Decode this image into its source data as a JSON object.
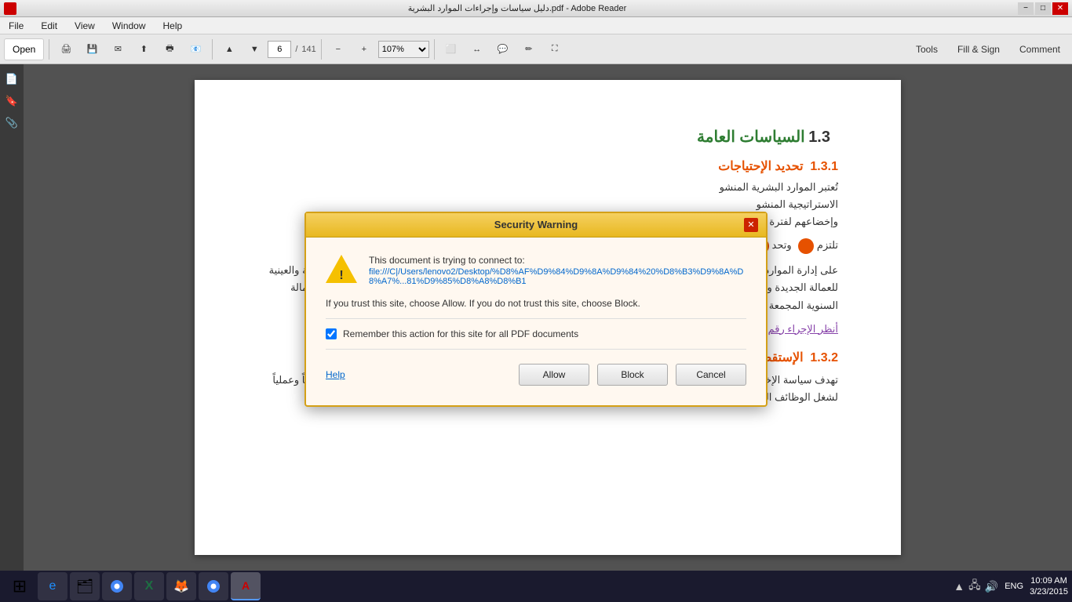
{
  "titlebar": {
    "title": "دليل سياسات وإجراءات الموارد البشرية.pdf - Adobe Reader",
    "minimize": "−",
    "maximize": "□",
    "close": "✕"
  },
  "menubar": {
    "items": [
      "File",
      "Edit",
      "View",
      "Window",
      "Help"
    ]
  },
  "toolbar": {
    "open_label": "Open",
    "page_current": "6",
    "page_total": "141",
    "zoom_value": "107%",
    "tools_label": "Tools",
    "fill_sign_label": "Fill & Sign",
    "comment_label": "Comment"
  },
  "pdf": {
    "section_num": "1.3",
    "section_title": "السياسات العامة",
    "subsection1_num": "1.3.1",
    "subsection1_title": "تحديد الإحتياجات",
    "subsection1_text1": "تُعتبر الموارد البشرية المنشو",
    "subsection1_text2": "الاستراتيجية المنشو",
    "subsection1_text3": "وإخضاعهم لفترة إخ",
    "subsection1_text4": "تلتزم",
    "subsection1_text5": "وتحد",
    "subsection1_body": "على إدارة الموارد البشرية إصدار خطة العمالة السنوية والتي تتضمن الميزانية التقديرية السنوية المتعلقة بالمرتبات والمزايا النقدية والعينية للعمالة الجديدة وعرضها على الإدارة العليا وإعتمادها في موعد غايته قبل نهاية ذات العام الميلادي، ويخضع أي تعديل على خطة العمالة السنوية المجمعة المعتمدة لدراسة مدير إدارة الموارد البشرية وإعتماد الإدارة العُليا.",
    "pdf_link": "أنظر الإجراء رقم (ع.م.ب.01/01) و رقم (ع.م.ب.01/02)",
    "subsection2_num": "1.3.2",
    "subsection2_title": "الإستقطاب والإختياروالتعيين",
    "subsection2_body": "تهدف سياسة الإختيار والتعيين إلى وضع النظام وإصدار التعليمات وتحديد المسئوليات لدعم الشركة بالعناصر البشرية المؤهلة علمياً وعملياً لشغل الوظائف الشاغرة بالهيكل التنظيمي المعتمد وذلك لتطوير الأداء وتحقيق الأهداف الإستراتيجية للشركة."
  },
  "dialog": {
    "title": "Security Warning",
    "message_line1": "This document is trying to connect to:",
    "url": "file:///C|/Users/lenovo2/Desktop/%D8%AF%D9%84%D9%8A%D9%84%20%D8%B3%D9%8A%D8%A7%...81%D9%85%D8%A8%D8%B1",
    "trust_message": "If you trust this site, choose Allow. If you do not trust this site, choose Block.",
    "checkbox_label": "Remember this action for this site for all PDF documents",
    "checkbox_checked": true,
    "help_label": "Help",
    "allow_label": "Allow",
    "block_label": "Block",
    "cancel_label": "Cancel"
  },
  "taskbar": {
    "apps": [
      {
        "name": "start",
        "icon": "⊞",
        "active": false
      },
      {
        "name": "ie",
        "icon": "🌐",
        "active": false
      },
      {
        "name": "explorer",
        "icon": "📁",
        "active": false
      },
      {
        "name": "chrome",
        "icon": "◉",
        "active": false
      },
      {
        "name": "excel",
        "icon": "X",
        "active": false
      },
      {
        "name": "firefox",
        "icon": "🦊",
        "active": false
      },
      {
        "name": "chrome2",
        "icon": "◉",
        "active": false
      },
      {
        "name": "acrobat",
        "icon": "A",
        "active": true
      }
    ],
    "tray": {
      "time": "10:09 AM",
      "date": "3/23/2015",
      "lang": "ENG"
    }
  }
}
